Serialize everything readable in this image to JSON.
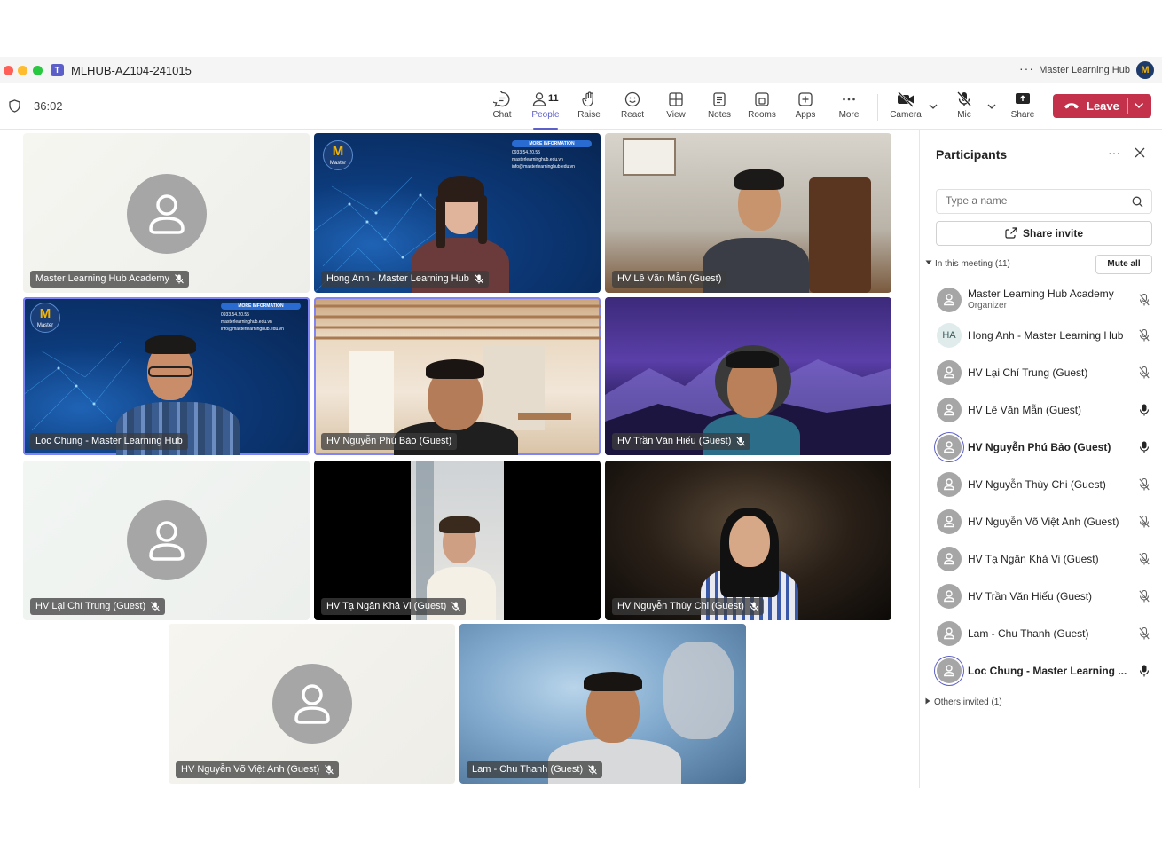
{
  "window": {
    "title": "MLHUB-AZ104-241015",
    "org_name": "Master Learning Hub",
    "org_avatar_letter": "M"
  },
  "toolbar": {
    "timer": "36:02",
    "people_count": "11",
    "buttons": {
      "chat": "Chat",
      "people": "People",
      "raise": "Raise",
      "react": "React",
      "view": "View",
      "notes": "Notes",
      "rooms": "Rooms",
      "apps": "Apps",
      "more": "More",
      "camera": "Camera",
      "mic": "Mic",
      "share": "Share",
      "leave": "Leave"
    },
    "leave_color": "#c4314b",
    "accent_color": "#5b5fc7"
  },
  "stage": {
    "tiles": [
      {
        "name": "Master Learning Hub Academy",
        "video": false,
        "muted": true
      },
      {
        "name": "Hong Anh - Master Learning Hub",
        "video": true,
        "muted": true
      },
      {
        "name": "HV Lê Văn Mẫn (Guest)",
        "video": true,
        "muted": false
      },
      {
        "name": "Loc Chung - Master Learning Hub",
        "video": true,
        "muted": false,
        "highlighted": true
      },
      {
        "name": "HV Nguyễn Phú Bảo (Guest)",
        "video": true,
        "muted": false,
        "highlighted": true
      },
      {
        "name": "HV Trần Văn Hiếu (Guest)",
        "video": true,
        "muted": true
      },
      {
        "name": "HV Lại Chí Trung (Guest)",
        "video": false,
        "muted": true
      },
      {
        "name": "HV Tạ Ngân Khả Vi (Guest)",
        "video": true,
        "muted": true
      },
      {
        "name": "HV Nguyễn Thùy Chi (Guest)",
        "video": true,
        "muted": true
      },
      {
        "name": "HV Nguyễn Võ Việt Anh (Guest)",
        "video": false,
        "muted": true
      },
      {
        "name": "Lam - Chu Thanh (Guest)",
        "video": true,
        "muted": true
      }
    ],
    "bg_logo_text": "Master",
    "bg_more_info": "MORE INFORMATION",
    "bg_contacts": [
      "0933.54.20.55",
      "masterlearninghub.edu.vn",
      "info@masterlearninghub.edu.vn"
    ]
  },
  "panel": {
    "title": "Participants",
    "search_placeholder": "Type a name",
    "share_invite": "Share invite",
    "in_meeting": "In this meeting (11)",
    "mute_all": "Mute all",
    "others_invited": "Others invited (1)",
    "participants": [
      {
        "name": "Master Learning Hub Academy",
        "role": "Organizer",
        "muted": true
      },
      {
        "name": "Hong Anh - Master Learning Hub",
        "initials": "HA",
        "muted": true
      },
      {
        "name": "HV Lại Chí Trung (Guest)",
        "muted": true
      },
      {
        "name": "HV Lê Văn Mẫn (Guest)",
        "muted": false
      },
      {
        "name": "HV Nguyễn Phú Bảo (Guest)",
        "muted": false,
        "speaking": true
      },
      {
        "name": "HV Nguyễn Thùy Chi (Guest)",
        "muted": true
      },
      {
        "name": "HV Nguyễn Võ Việt Anh (Guest)",
        "muted": true
      },
      {
        "name": "HV Tạ Ngân Khả Vi (Guest)",
        "muted": true
      },
      {
        "name": "HV Trần Văn Hiếu (Guest)",
        "muted": true
      },
      {
        "name": "Lam - Chu Thanh (Guest)",
        "muted": true
      },
      {
        "name": "Loc Chung - Master Learning ...",
        "muted": false,
        "speaking": true
      }
    ]
  }
}
